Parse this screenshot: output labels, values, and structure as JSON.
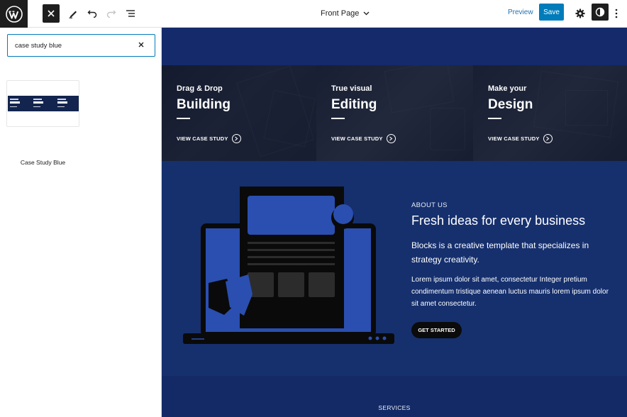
{
  "toolbar": {
    "logo_icon": "wordpress-logo",
    "close_icon": "close-icon",
    "document_title": "Front Page",
    "preview_label": "Preview",
    "save_label": "Save"
  },
  "inserter": {
    "search_value": "case study blue",
    "search_placeholder": "Search",
    "results": [
      {
        "label": "Case Study Blue",
        "thumb_items": [
          "Drag & Drop",
          "True visual",
          "Make your"
        ]
      }
    ]
  },
  "canvas": {
    "case_studies": [
      {
        "subtitle": "Drag & Drop",
        "title": "Building",
        "link": "VIEW CASE STUDY"
      },
      {
        "subtitle": "True visual",
        "title": "Editing",
        "link": "VIEW CASE STUDY"
      },
      {
        "subtitle": "Make your",
        "title": "Design",
        "link": "VIEW CASE STUDY"
      }
    ],
    "about": {
      "kicker": "ABOUT US",
      "title": "Fresh ideas for every business",
      "lead": "Blocks is a creative template that specializes in strategy creativity.",
      "body": "Lorem ipsum dolor sit amet, consectetur Integer pretium condimentum tristique aenean luctus mauris lorem ipsum dolor sit amet consectetur.",
      "button": "GET STARTED"
    },
    "services_label": "SERVICES"
  },
  "colors": {
    "accent": "#007cba",
    "canvas_blue": "#16306e",
    "illustration_blue": "#2a4fb0"
  }
}
